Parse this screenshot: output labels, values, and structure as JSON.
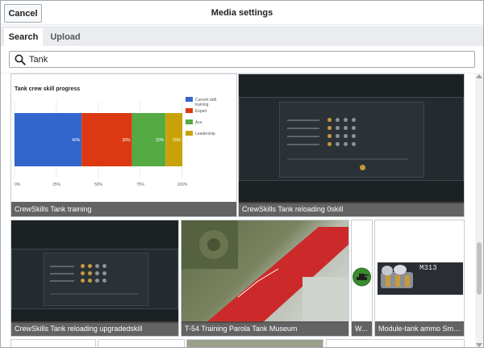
{
  "header": {
    "cancel_label": "Cancel",
    "title": "Media settings"
  },
  "tabs": [
    {
      "label": "Search",
      "active": true
    },
    {
      "label": "Upload",
      "active": false
    }
  ],
  "search": {
    "value": "Tank"
  },
  "results": [
    {
      "caption": "CrewSkills Tank training"
    },
    {
      "caption": "CrewSkills Tank reloading 0skill"
    },
    {
      "caption": "CrewSkills Tank reloading upgradedskill"
    },
    {
      "caption": "T-54 Training Parola Tank Museum"
    },
    {
      "caption": "W..."
    },
    {
      "caption": "Module-tank ammo Smok..."
    },
    {
      "thumb_text": "M313"
    }
  ],
  "chart_data": {
    "type": "bar",
    "orientation": "horizontal-stacked",
    "title": "Tank crew skill progress",
    "categories": [
      ""
    ],
    "series": [
      {
        "name": "Current skill training",
        "values": [
          40
        ],
        "label": "40%",
        "color": "#3366cc"
      },
      {
        "name": "Expert",
        "values": [
          30
        ],
        "label": "30%",
        "color": "#dc3912"
      },
      {
        "name": "Ace",
        "values": [
          20
        ],
        "label": "20%",
        "color": "#55aa44"
      },
      {
        "name": "Leadership",
        "values": [
          10
        ],
        "label": "10%",
        "color": "#c9a20a"
      }
    ],
    "xticks": [
      "0%",
      "25%",
      "50%",
      "75%",
      "100%"
    ],
    "xlim": [
      0,
      100
    ],
    "legend": "right"
  },
  "colors": {
    "caption_bg": "#484848",
    "tab_bar": "#eaecf0",
    "tank_icon_green": "#3a8c2f",
    "crane_red": "#d42b2b"
  }
}
